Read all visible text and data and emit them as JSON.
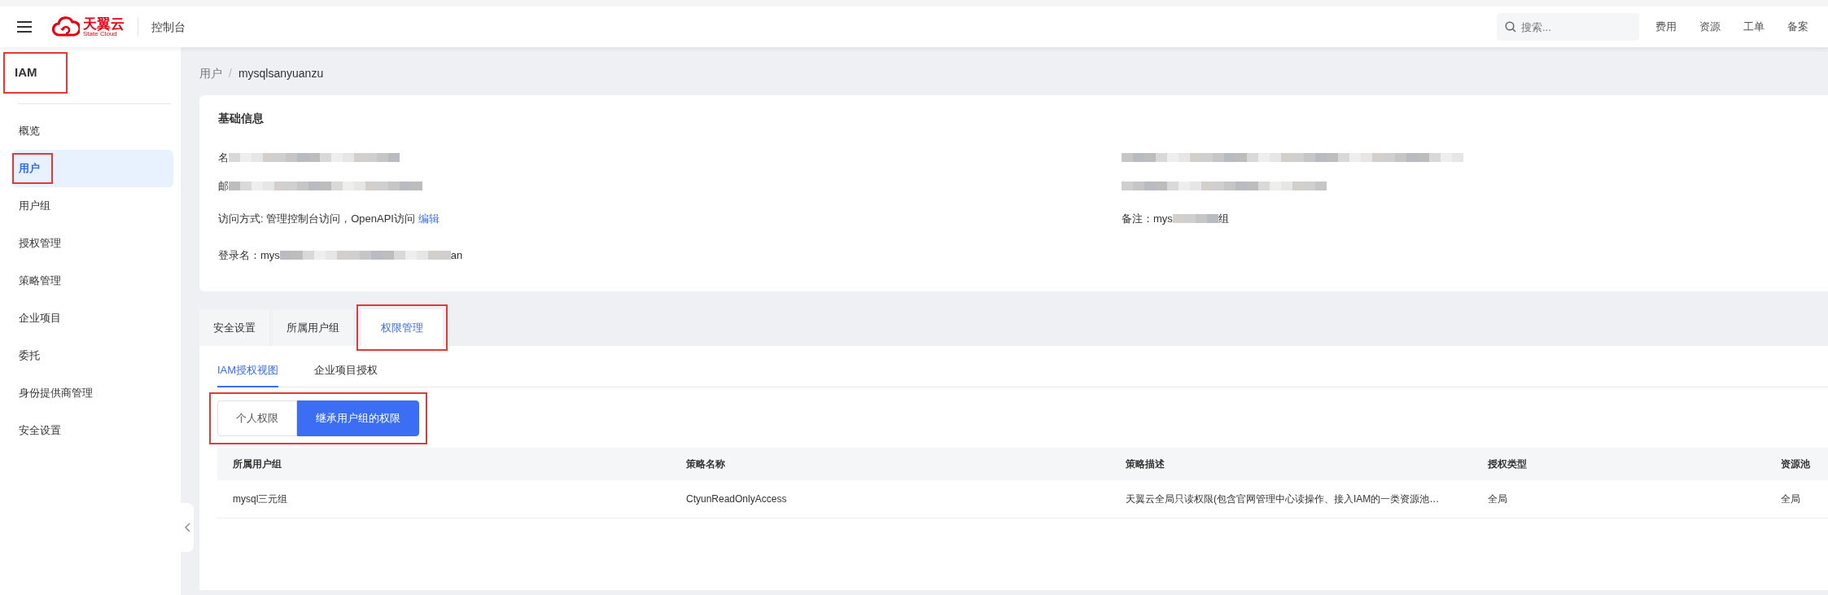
{
  "header": {
    "brand": {
      "name": "天翼云",
      "tagline": "State Cloud"
    },
    "title": "控制台",
    "search": {
      "placeholder": "搜索..."
    },
    "links": [
      "费用",
      "资源",
      "工单",
      "备案"
    ]
  },
  "sidebar": {
    "title": "IAM",
    "highlighted": true,
    "items": [
      {
        "label": "概览",
        "selected": false,
        "highlighted": false
      },
      {
        "label": "用户",
        "selected": true,
        "highlighted": true
      },
      {
        "label": "用户组",
        "selected": false,
        "highlighted": false
      },
      {
        "label": "授权管理",
        "selected": false,
        "highlighted": false
      },
      {
        "label": "策略管理",
        "selected": false,
        "highlighted": false
      },
      {
        "label": "企业项目",
        "selected": false,
        "highlighted": false
      },
      {
        "label": "委托",
        "selected": false,
        "highlighted": false
      },
      {
        "label": "身份提供商管理",
        "selected": false,
        "highlighted": false
      },
      {
        "label": "安全设置",
        "selected": false,
        "highlighted": false
      }
    ]
  },
  "breadcrumb": {
    "separator": "/",
    "items": [
      "用户",
      "mysqlsanyuanzu"
    ]
  },
  "basic_info": {
    "title": "基础信息",
    "left": [
      {
        "label": "名",
        "redacted": true
      },
      {
        "label": "邮",
        "redacted": true
      },
      {
        "label": "访问方式: 管理控制台访问，OpenAPI访问",
        "link": "编辑",
        "redacted": false
      },
      {
        "label": "登录名：mys",
        "redacted": true,
        "suffix": "an"
      }
    ],
    "right": [
      {
        "redacted": true
      },
      {
        "redacted": true
      },
      {
        "label": "备注：mys",
        "redacted": true,
        "suffix": "组"
      }
    ]
  },
  "tabs": [
    {
      "label": "安全设置",
      "selected": false,
      "highlighted": false
    },
    {
      "label": "所属用户组",
      "selected": false,
      "highlighted": false
    },
    {
      "label": "权限管理",
      "selected": true,
      "highlighted": true
    }
  ],
  "sub_tabs": [
    {
      "label": "IAM授权视图",
      "selected": true
    },
    {
      "label": "企业项目授权",
      "selected": false
    }
  ],
  "segments": {
    "highlighted": true,
    "items": [
      {
        "label": "个人权限",
        "selected": false
      },
      {
        "label": "继承用户组的权限",
        "selected": true
      }
    ]
  },
  "table": {
    "columns": [
      "所属用户组",
      "策略名称",
      "策略描述",
      "授权类型",
      "资源池"
    ],
    "rows": [
      [
        "mysql三元组",
        "CtyunReadOnlyAccess",
        "天翼云全局只读权限(包含官网管理中心读操作、接入IAM的一类资源池…",
        "全局",
        "全局"
      ]
    ]
  }
}
